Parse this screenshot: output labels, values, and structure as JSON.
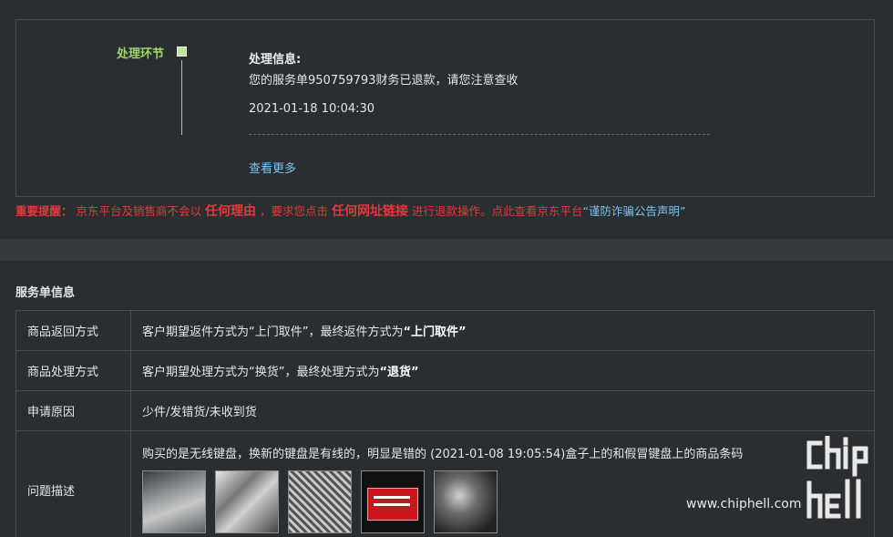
{
  "process": {
    "stage_label": "处理环节",
    "info_title": "处理信息:",
    "info_text": "您的服务单950759793财务已退款，请您注意查收",
    "info_time": "2021-01-18 10:04:30",
    "more_link": "查看更多"
  },
  "warning": {
    "lead": "重要提醒：",
    "t1": "京东平台及销售商不会以",
    "b1": "任何理由",
    "t2": "，要求您点击",
    "b2": "任何网址链接",
    "t3": "进行退款操作。点此查看京东平台",
    "link": "“谨防诈骗公告声明”"
  },
  "section_title": "服务单信息",
  "table": {
    "return_label": "商品返回方式",
    "return_value_prefix": "客户期望返件方式为“上门取件”，最终返件方式为",
    "return_value_bold": "“上门取件”",
    "handle_label": "商品处理方式",
    "handle_value_prefix": "客户期望处理方式为“换货”，最终处理方式为",
    "handle_value_bold": "“退货”",
    "reason_label": "申请原因",
    "reason_value": "少件/发错货/未收到货",
    "desc_label": "问题描述",
    "desc_value": "购买的是无线键盘，换新的键盘是有线的，明显是错的 (2021-01-08 19:05:54)盒子上的和假冒键盘上的商品条码"
  },
  "watermark": {
    "site": "www.chiphell.com",
    "logo": "chip hell"
  },
  "colors": {
    "background": "#2b2e31",
    "accent_green": "#9ed86a",
    "warning_red": "#e23a3a",
    "link_blue": "#7cc4ef"
  }
}
